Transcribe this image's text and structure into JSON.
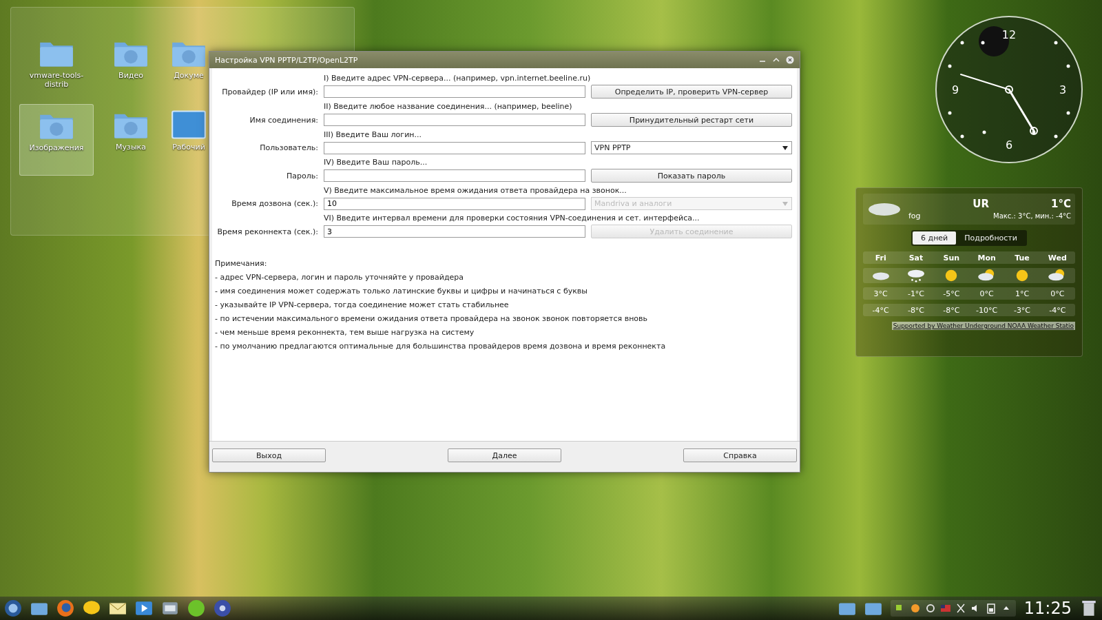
{
  "desktop_icons": [
    {
      "label": "vmware-tools-distrib",
      "kind": "plain",
      "selected": false
    },
    {
      "label": "Видео",
      "kind": "video",
      "selected": false
    },
    {
      "label": "Докуме",
      "kind": "docs",
      "selected": false
    },
    {
      "label": "Изображения",
      "kind": "pictures",
      "selected": true
    },
    {
      "label": "Музыка",
      "kind": "music",
      "selected": false
    },
    {
      "label": "Рабочий",
      "kind": "desktop",
      "selected": false
    }
  ],
  "dialog": {
    "title": "Настройка VPN PPTP/L2TP/OpenL2TP",
    "rows": [
      {
        "hint": "I) Введите адрес VPN-сервера... (например, vpn.internet.beeline.ru)",
        "label": "Провайдер (IP или имя):",
        "side": {
          "kind": "button",
          "label": "Определить IP, проверить VPN-сервер",
          "disabled": false
        }
      },
      {
        "hint": "II) Введите любое название соединения... (например, beeline)",
        "label": "Имя соединения:",
        "side": {
          "kind": "button",
          "label": "Принудительный рестарт сети",
          "disabled": false
        }
      },
      {
        "hint": "III) Введите Ваш логин...",
        "label": "Пользователь:",
        "side": {
          "kind": "dropdown",
          "label": "VPN PPTP",
          "disabled": false
        }
      },
      {
        "hint": "IV) Введите Ваш пароль...",
        "label": "Пароль:",
        "side": {
          "kind": "button",
          "label": "Показать пароль",
          "disabled": false
        }
      },
      {
        "hint": "V) Введите максимальное время ожидания ответа провайдера на звонок...",
        "label": "Время дозвона (сек.):",
        "value": "10",
        "side": {
          "kind": "dropdown",
          "label": "Mandriva и аналоги",
          "disabled": true
        }
      },
      {
        "hint": "VI) Введите интервал времени для проверки состояния VPN-соединения и сет. интерфейса...",
        "label": "Время реконнекта (сек.):",
        "value": "3",
        "side": {
          "kind": "button",
          "label": "Удалить соединение",
          "disabled": true
        }
      }
    ],
    "notes_title": "Примечания:",
    "notes": [
      "- адрес VPN-сервера, логин и пароль уточняйте у провайдера",
      "- имя соединения может содержать только латинские буквы и цифры и начинаться с буквы",
      "- указывайте IP VPN-сервера, тогда соединение может стать стабильнее",
      "- по истечении максимального времени ожидания ответа провайдера на звонок звонок повторяется вновь",
      "- чем меньше время реконнекта, тем выше нагрузка на систему",
      "- по умолчанию предлагаются оптимальные для большинства провайдеров время дозвона и время реконнекта"
    ],
    "buttons": [
      "Выход",
      "Далее",
      "Справка"
    ]
  },
  "clock": {
    "numbers": [
      "12",
      "3",
      "6",
      "9"
    ]
  },
  "weather": {
    "location": "UR",
    "temperature": "1°C",
    "condition": "fog",
    "range": "Макс.: 3°C, мин.: -4°C",
    "tabs": [
      {
        "label": "6 дней",
        "selected": true
      },
      {
        "label": "Подробности",
        "selected": false
      }
    ],
    "days": [
      {
        "day": "Fri",
        "kind": "cloudy",
        "high": "3°C",
        "low": "-4°C"
      },
      {
        "day": "Sat",
        "kind": "snow",
        "high": "-1°C",
        "low": "-8°C"
      },
      {
        "day": "Sun",
        "kind": "sunny",
        "high": "-5°C",
        "low": "-8°C"
      },
      {
        "day": "Mon",
        "kind": "partly-cloudy",
        "high": "0°C",
        "low": "-10°C"
      },
      {
        "day": "Tue",
        "kind": "sunny",
        "high": "1°C",
        "low": "-3°C"
      },
      {
        "day": "Wed",
        "kind": "partly-cloudy",
        "high": "0°C",
        "low": "-4°C"
      }
    ],
    "footer": "Supported by Weather Underground NOAA Weather Statio"
  },
  "taskbar": {
    "time": "11:25"
  }
}
